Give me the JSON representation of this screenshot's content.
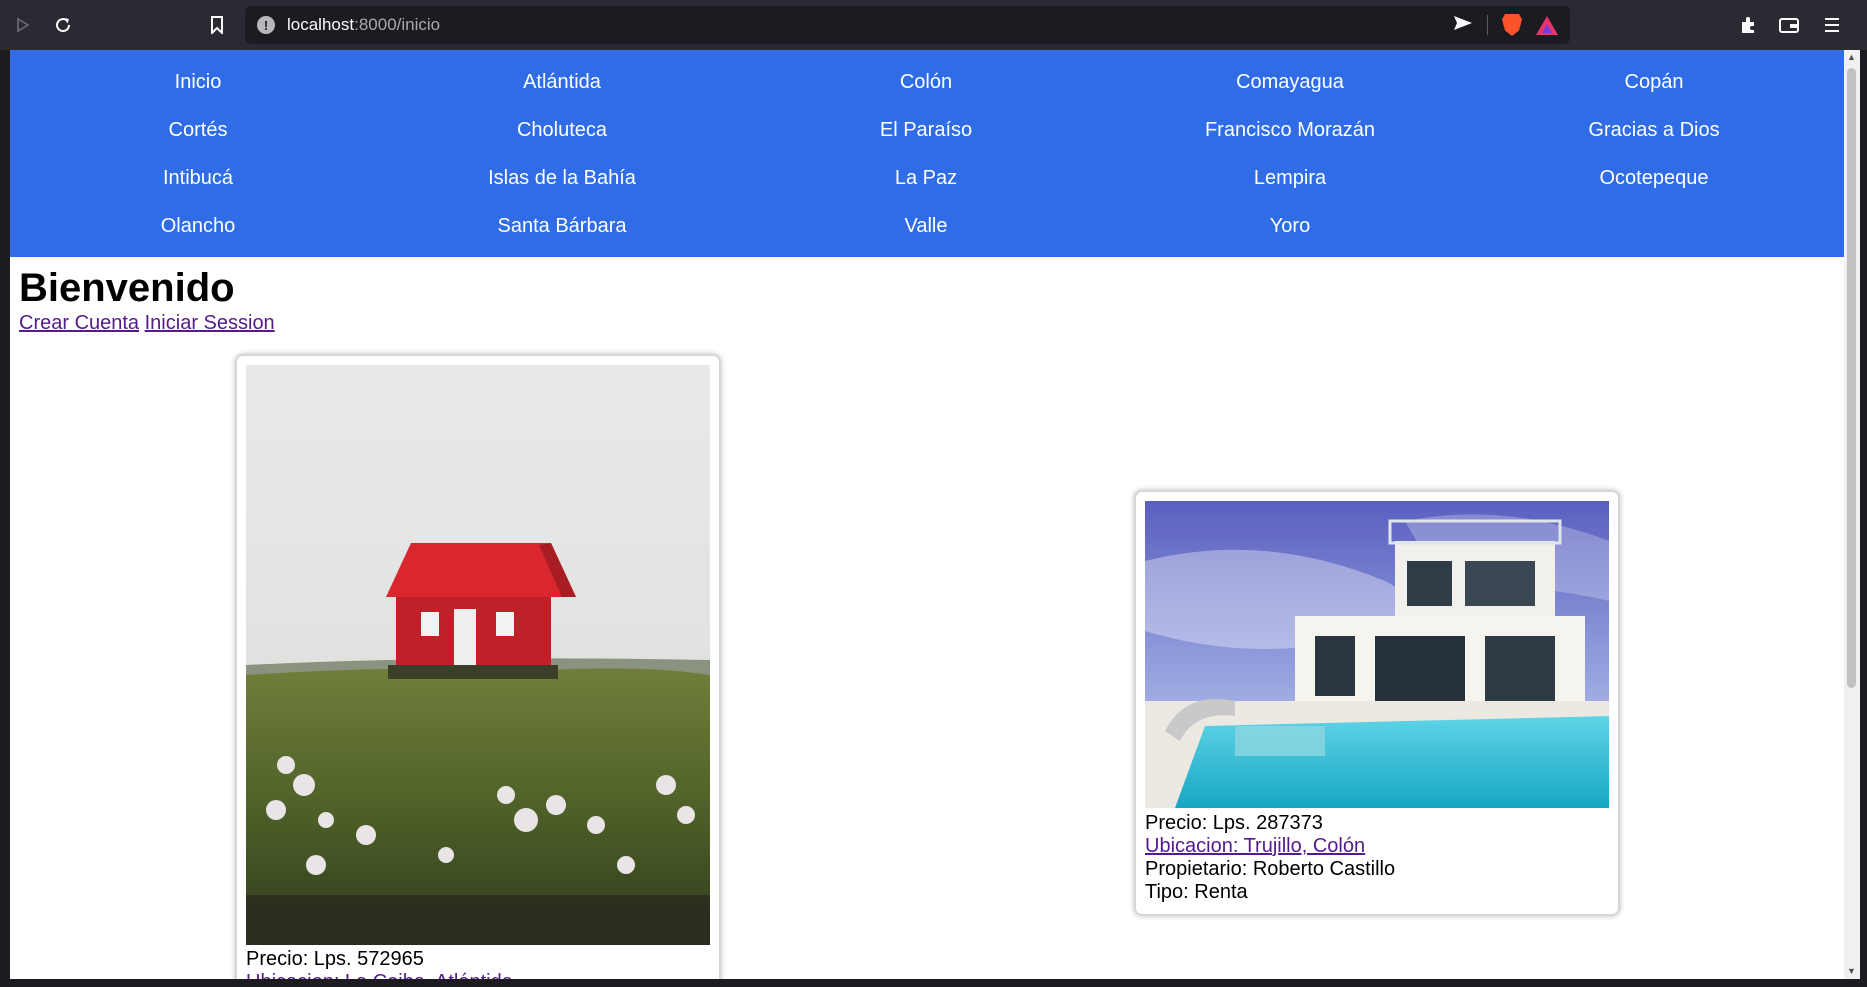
{
  "browser": {
    "url_host": "localhost",
    "url_path": ":8000/inicio"
  },
  "nav": {
    "items": [
      "Inicio",
      "Atlántida",
      "Colón",
      "Comayagua",
      "Copán",
      "Cortés",
      "Choluteca",
      "El Paraíso",
      "Francisco Morazán",
      "Gracias a Dios",
      "Intibucá",
      "Islas de la Bahía",
      "La Paz",
      "Lempira",
      "Ocotepeque",
      "Olancho",
      "Santa Bárbara",
      "Valle",
      "Yoro"
    ]
  },
  "page": {
    "title": "Bienvenido",
    "create_account": "Crear Cuenta",
    "login": "Iniciar Session"
  },
  "listings": [
    {
      "price": "Precio: Lps. 572965",
      "location": "Ubicacion: La Ceiba, Atlántida",
      "image": "red-house-on-hill"
    },
    {
      "price": "Precio: Lps. 287373",
      "location": "Ubicacion: Trujillo, Colón",
      "owner": "Propietario: Roberto Castillo",
      "type": "Tipo: Renta",
      "image": "modern-house-with-pool"
    }
  ],
  "colors": {
    "nav_bg": "#2f6ce5",
    "link": "#551a8b",
    "chrome_bg": "#2b2a33"
  }
}
